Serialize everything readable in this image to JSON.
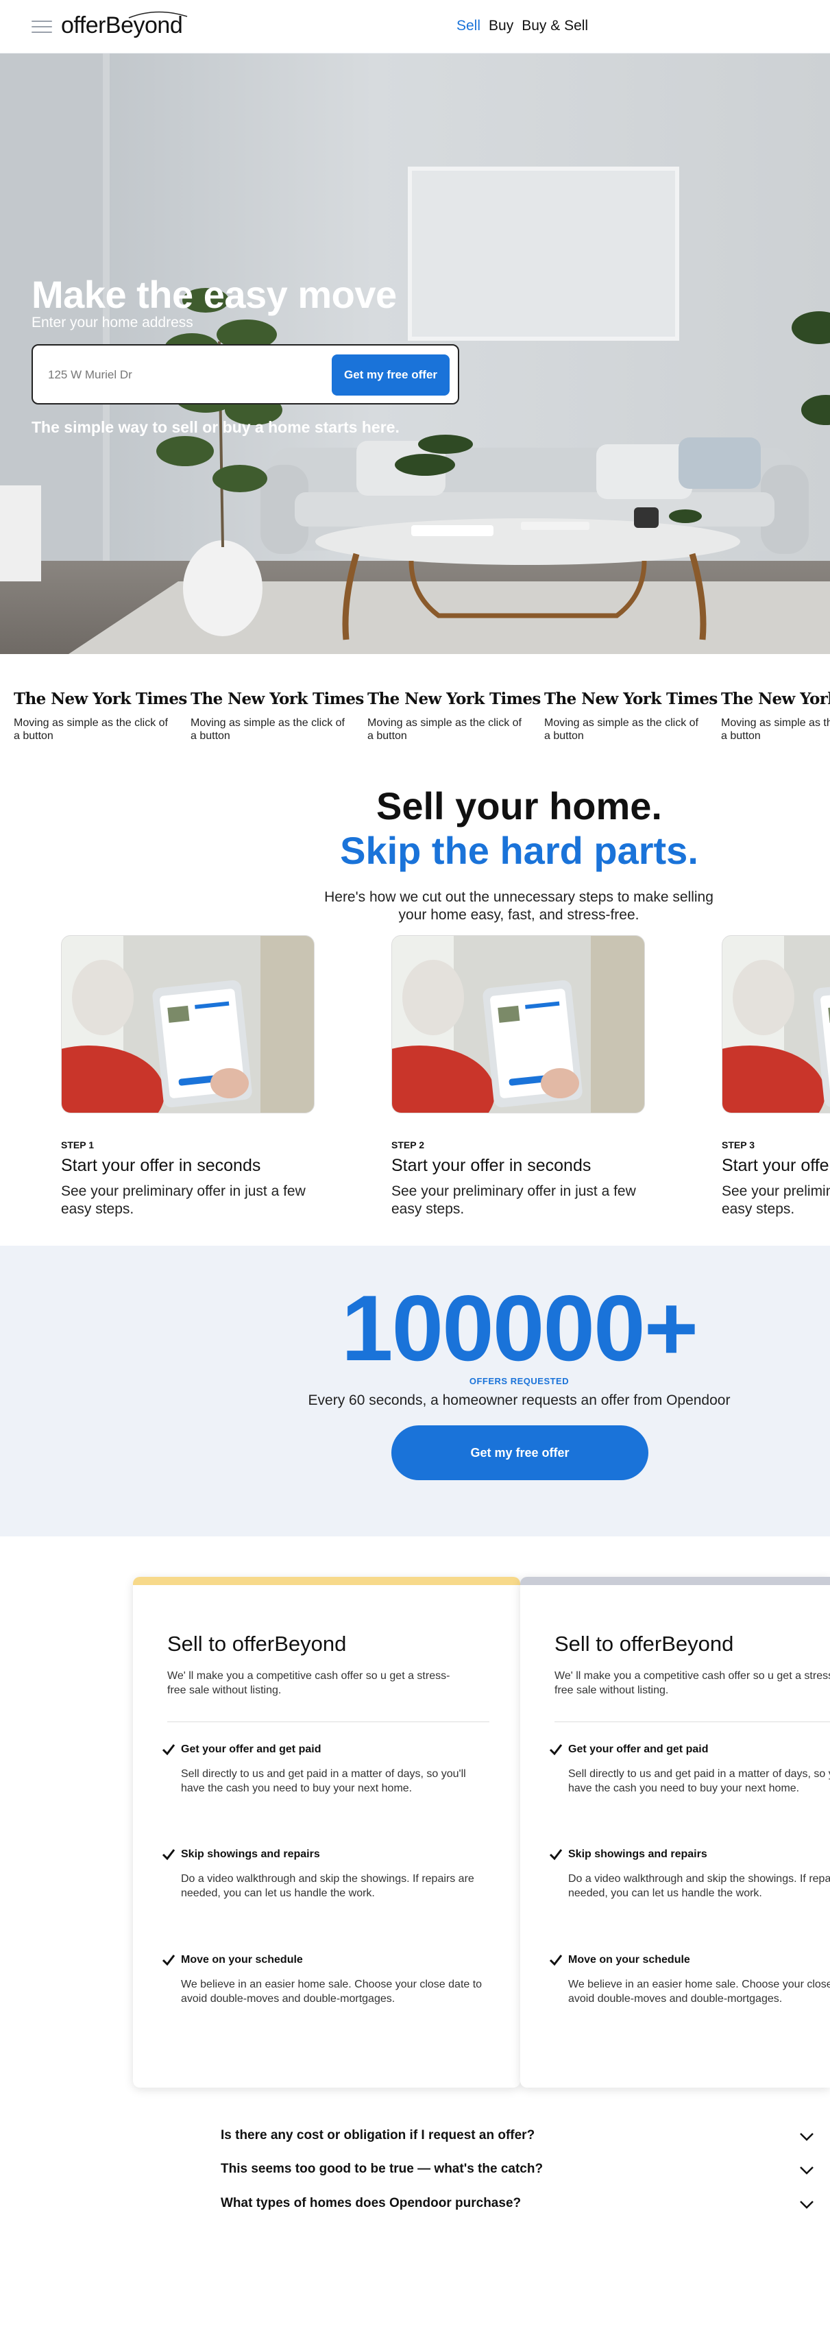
{
  "header": {
    "logo": "offerBeyond",
    "nav": [
      {
        "label": "Sell",
        "active": true
      },
      {
        "label": "Buy",
        "active": false
      },
      {
        "label": "Buy & Sell",
        "active": false
      }
    ],
    "menu_icon": "hamburger-menu-icon"
  },
  "hero": {
    "title": "Make the easy move",
    "subtitle": "Enter your home address",
    "address_placeholder": "125 W Muriel Dr",
    "cta": "Get my free offer",
    "tagline": "The simple way to sell or buy a home starts here."
  },
  "press": [
    {
      "logo": "The New York Times",
      "text": "Moving as simple as the click of a button"
    },
    {
      "logo": "The New York Times",
      "text": "Moving as simple as the click of a button"
    },
    {
      "logo": "The New York Times",
      "text": "Moving as simple as the click of a button"
    },
    {
      "logo": "The New York Times",
      "text": "Moving as simple as the click of a button"
    },
    {
      "logo": "The New York Times",
      "text": "Moving as simple as the click of a button"
    }
  ],
  "steps_section": {
    "heading": "Sell your home.",
    "heading_accent": "Skip the hard parts.",
    "description": "Here's how we cut out the unnecessary steps to make selling your home easy, fast, and stress-free.",
    "steps": [
      {
        "label": "STEP 1",
        "title": "Start your offer in seconds",
        "text": "See your preliminary offer in just a few easy steps."
      },
      {
        "label": "STEP 2",
        "title": "Start your offer in seconds",
        "text": "See your preliminary offer in just a few easy steps."
      },
      {
        "label": "STEP 3",
        "title": "Start your offer in seconds",
        "text": "See your preliminary offer in just a few easy steps."
      }
    ]
  },
  "stats": {
    "number": "100000+",
    "label": "OFFERS REQUESTED",
    "text": "Every 60 seconds, a homeowner requests an offer from Opendoor",
    "cta": "Get my free offer"
  },
  "cards": [
    {
      "accent": "#f7d98a",
      "title": "Sell to offerBeyond",
      "description": "We' ll make you a competitive cash offer so u get a stress-free sale without listing.",
      "features": [
        {
          "title": "Get your offer and get paid",
          "text": "Sell directly to us and get paid in a matter of days, so you'll have the cash you need to buy your next home."
        },
        {
          "title": "Skip showings and repairs",
          "text": "Do a video walkthrough and skip the showings. If repairs are needed, you can let us handle the work."
        },
        {
          "title": "Move on your schedule",
          "text": "We believe in an easier home sale. Choose your close date to avoid double-moves and double-mortgages."
        }
      ]
    },
    {
      "accent": "#c9ccd6",
      "title": "Sell to offerBeyond",
      "description": "We' ll make you a competitive cash offer so u get a stress-free sale without listing.",
      "features": [
        {
          "title": "Get your offer and get paid",
          "text": "Sell directly to us and get paid in a matter of days, so you'll have the cash you need to buy your next home."
        },
        {
          "title": "Skip showings and repairs",
          "text": "Do a video walkthrough and skip the showings. If repairs are needed, you can let us handle the work."
        },
        {
          "title": "Move on your schedule",
          "text": "We believe in an easier home sale. Choose your close date to avoid double-moves and double-mortgages."
        }
      ]
    }
  ],
  "faq": [
    {
      "question": "Is there any cost or obligation if I request an offer?"
    },
    {
      "question": "This seems too good to be true — what's the catch?"
    },
    {
      "question": "What types of homes does Opendoor purchase?"
    }
  ],
  "colors": {
    "brand": "#1a73d9",
    "stats_bg": "#eef2f8"
  }
}
